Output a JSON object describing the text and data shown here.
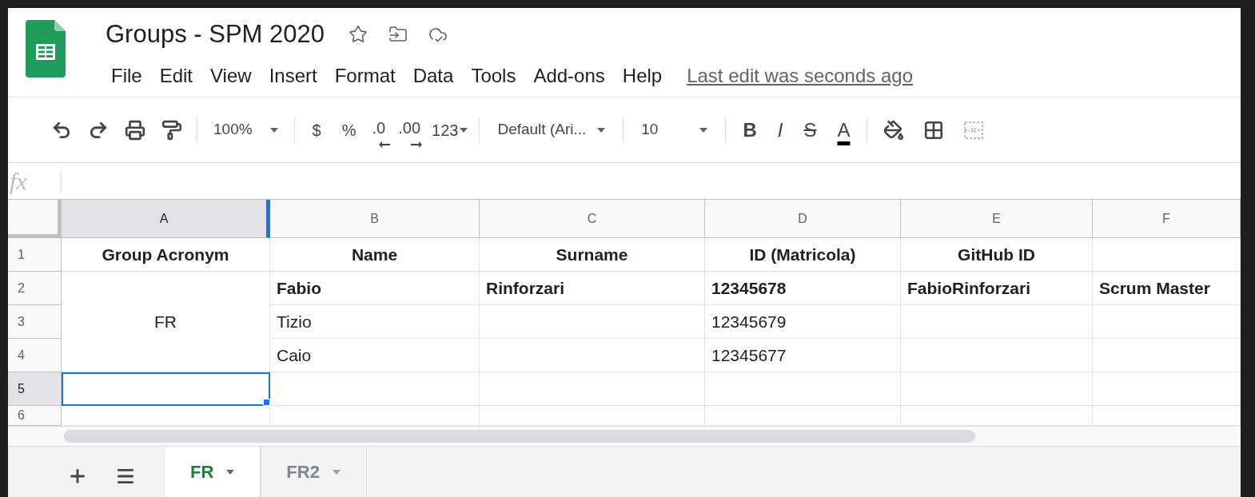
{
  "document": {
    "title": "Groups - SPM 2020"
  },
  "menu": [
    "File",
    "Edit",
    "View",
    "Insert",
    "Format",
    "Data",
    "Tools",
    "Add-ons",
    "Help"
  ],
  "last_edit": "Last edit was seconds ago",
  "toolbar": {
    "zoom": "100%",
    "currency": "$",
    "percent": "%",
    "decrease_decimals": ".0",
    "increase_decimals": ".00",
    "number_format": "123",
    "font": "Default (Ari...",
    "font_size": "10",
    "format_buttons": [
      "B",
      "I",
      "S",
      "A"
    ]
  },
  "formula_bar": {
    "label": "fx"
  },
  "columns": [
    {
      "label": "A",
      "selected": true
    },
    {
      "label": "B",
      "selected": false
    },
    {
      "label": "C",
      "selected": false
    },
    {
      "label": "D",
      "selected": false
    },
    {
      "label": "E",
      "selected": false
    },
    {
      "label": "F",
      "selected": false
    }
  ],
  "rows": [
    {
      "number": "1",
      "selected": false,
      "cells": [
        {
          "text": "Group Acronym",
          "kind": "header",
          "selected": false
        },
        {
          "text": "Name",
          "kind": "header",
          "selected": false
        },
        {
          "text": "Surname",
          "kind": "header",
          "selected": false
        },
        {
          "text": "ID (Matricola)",
          "kind": "header",
          "selected": false
        },
        {
          "text": "GitHub ID",
          "kind": "header",
          "selected": false
        },
        {
          "selected": false
        }
      ]
    },
    {
      "number": "2",
      "selected": false,
      "cells": [
        {
          "text": "FR",
          "kind": "merged",
          "selected": false
        },
        {
          "text": "Fabio",
          "bold": true,
          "selected": false
        },
        {
          "text": "Rinforzari",
          "bold": true,
          "selected": false
        },
        {
          "text": "12345678",
          "bold": true,
          "selected": false
        },
        {
          "text": "FabioRinforzari",
          "bold": true,
          "selected": false
        },
        {
          "text": "Scrum Master",
          "bold": true,
          "selected": false
        }
      ]
    },
    {
      "number": "3",
      "selected": false,
      "cells": [
        {
          "kind": "covered"
        },
        {
          "text": "Tizio",
          "bold": false,
          "selected": false
        },
        {
          "selected": false
        },
        {
          "text": "12345679",
          "bold": false,
          "selected": false
        },
        {
          "selected": false
        },
        {
          "selected": false
        }
      ]
    },
    {
      "number": "4",
      "selected": false,
      "cells": [
        {
          "kind": "covered"
        },
        {
          "text": "Caio",
          "bold": false,
          "selected": false
        },
        {
          "selected": false
        },
        {
          "text": "12345677",
          "bold": false,
          "selected": false
        },
        {
          "selected": false
        },
        {
          "selected": false
        }
      ]
    },
    {
      "number": "5",
      "selected": true,
      "cells": [
        {
          "selected": true
        },
        {
          "selected": false
        },
        {
          "selected": false
        },
        {
          "selected": false
        },
        {
          "selected": false
        },
        {
          "selected": false
        }
      ]
    },
    {
      "number": "6",
      "selected": false,
      "cells": [
        {
          "selected": false
        },
        {
          "selected": false
        },
        {
          "selected": false
        },
        {
          "selected": false
        },
        {
          "selected": false
        },
        {
          "selected": false
        }
      ]
    }
  ],
  "sheet_tabs": [
    {
      "label": "FR",
      "selected": true
    },
    {
      "label": "FR2",
      "selected": false
    }
  ]
}
